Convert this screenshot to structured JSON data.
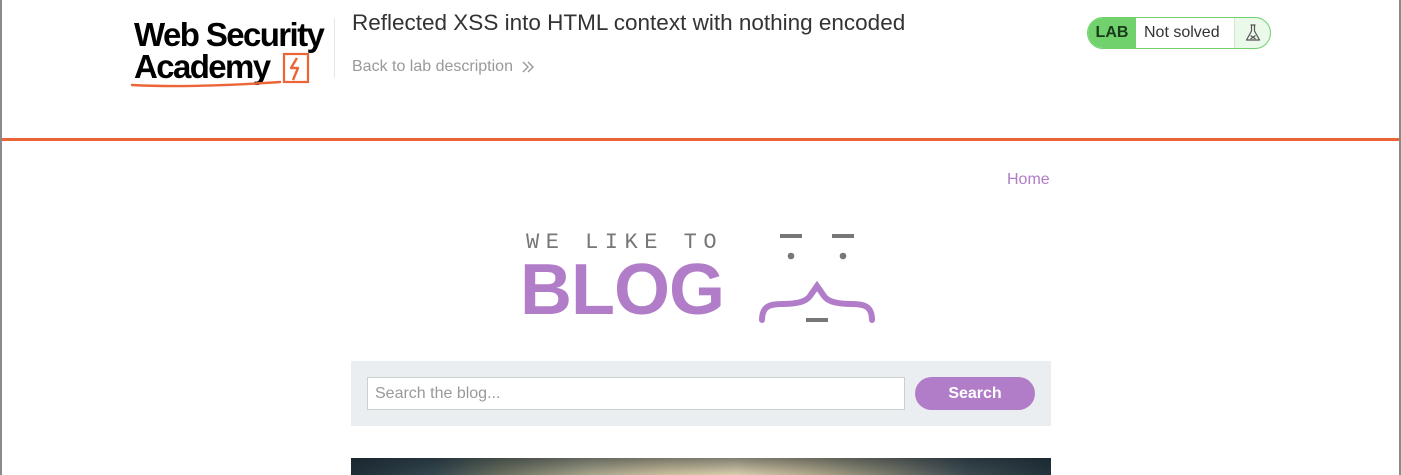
{
  "header": {
    "logo": {
      "line1": "Web Security",
      "line2": "Academy"
    },
    "lab_title": "Reflected XSS into HTML context with nothing encoded",
    "back_link": "Back to lab description",
    "lab_badge": "LAB",
    "lab_status": "Not solved",
    "accent_color": "#ec6536"
  },
  "blog": {
    "nav": {
      "home": "Home"
    },
    "banner": {
      "tagline": "WE LIKE TO",
      "title": "BLOG"
    },
    "search": {
      "placeholder": "Search the blog...",
      "value": "",
      "button": "Search"
    },
    "brand_color": "#b17cc8"
  },
  "icons": {
    "back": "double-chevron-right-icon",
    "flask": "flask-icon",
    "logo_bolt": "lightning-bolt-icon"
  }
}
